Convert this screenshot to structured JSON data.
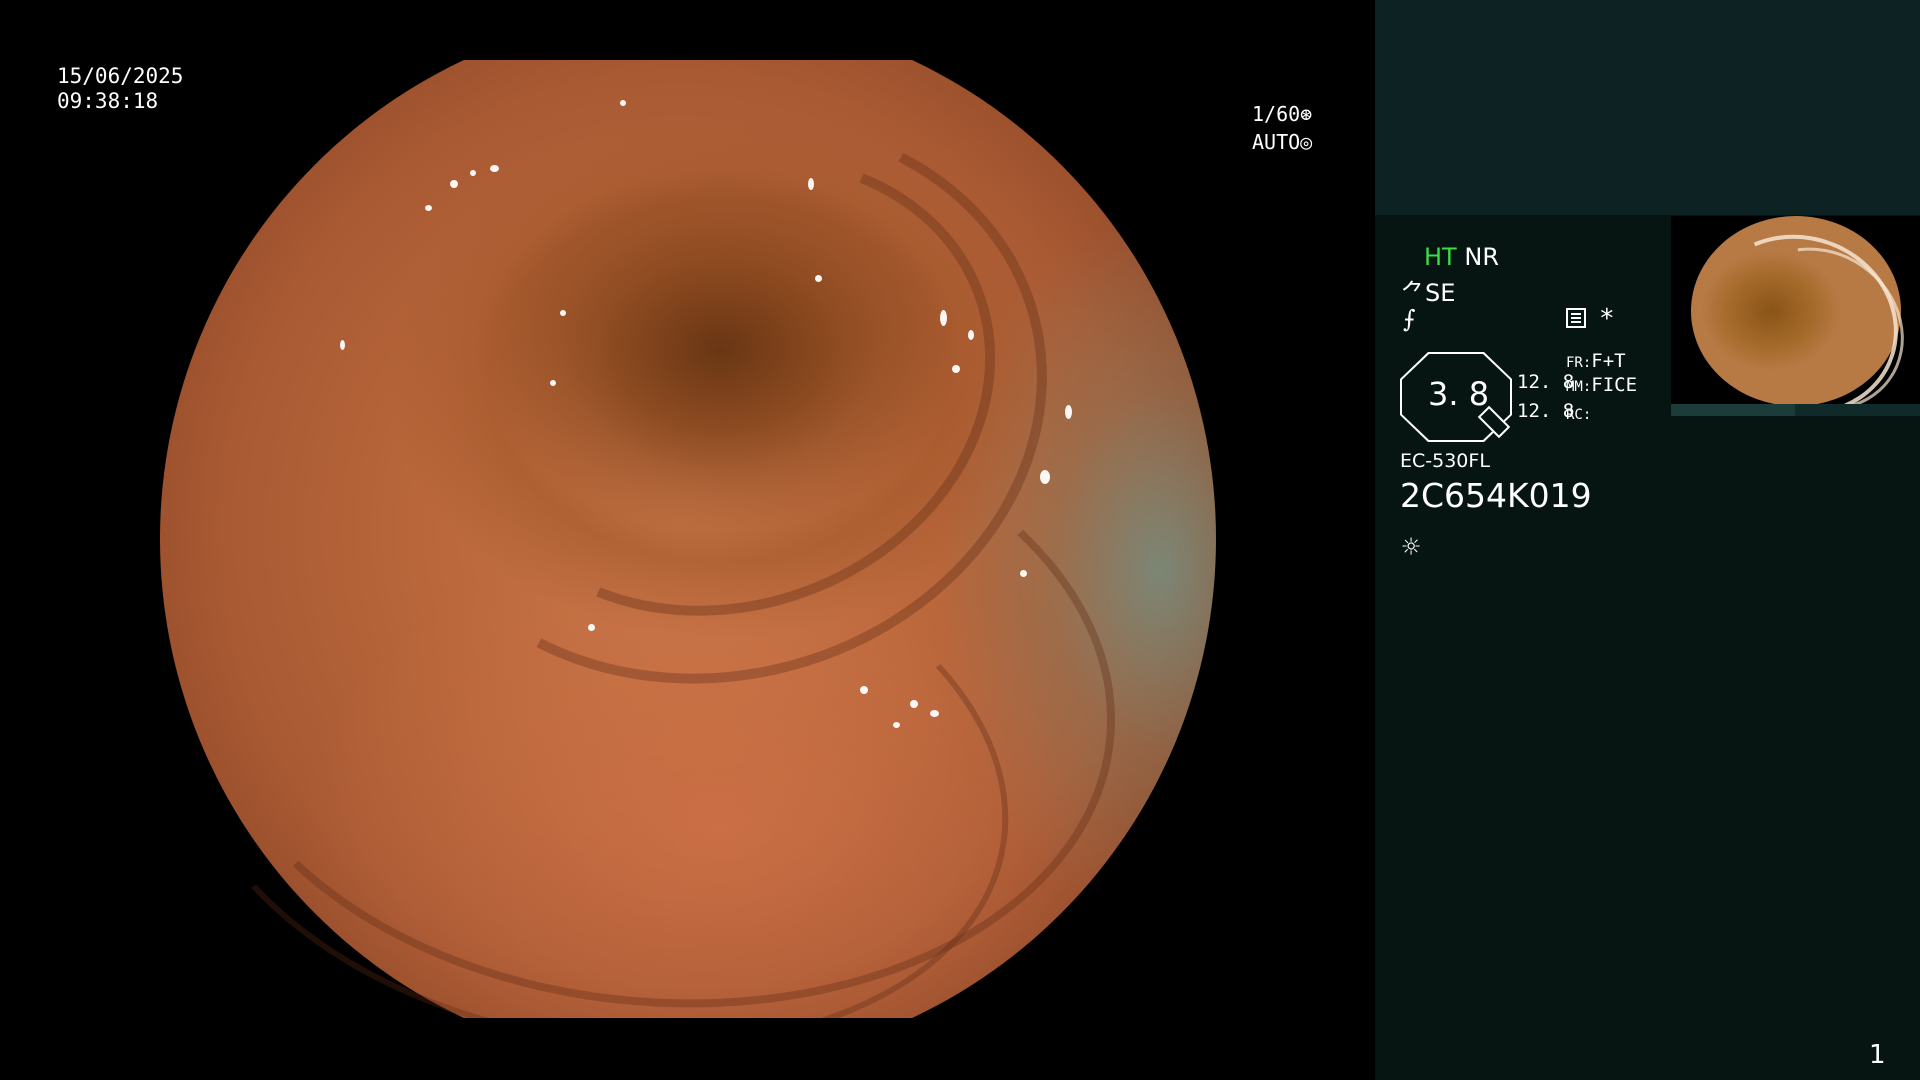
{
  "osd": {
    "date": "15/06/2025",
    "time": "09:38:18",
    "shutter": "1/60",
    "exposure_mode": "AUTO"
  },
  "panel": {
    "ht": "HT",
    "nr": "NR",
    "se": "SE",
    "f_symbol": "⨍",
    "star": "*",
    "zoom_value": "3. 8",
    "val1": "12. 8",
    "val2": "12. 8",
    "fr_label": "FR:",
    "fr_value": "F+T",
    "mm_label": "MM:",
    "mm_value": "FICE",
    "rc_label": "RC:",
    "model": "EC-530FL",
    "serial": "2C654K019",
    "page_number": "1"
  },
  "icons": {
    "shutter": "aperture-icon",
    "auto": "auto-exposure-icon",
    "scope": "endoscope-icon",
    "list": "list-icon",
    "light": "light-source-icon"
  },
  "colors": {
    "ht_green": "#3adf45",
    "panel_bg": "#061512",
    "panel_top_bg": "#0d2223"
  }
}
